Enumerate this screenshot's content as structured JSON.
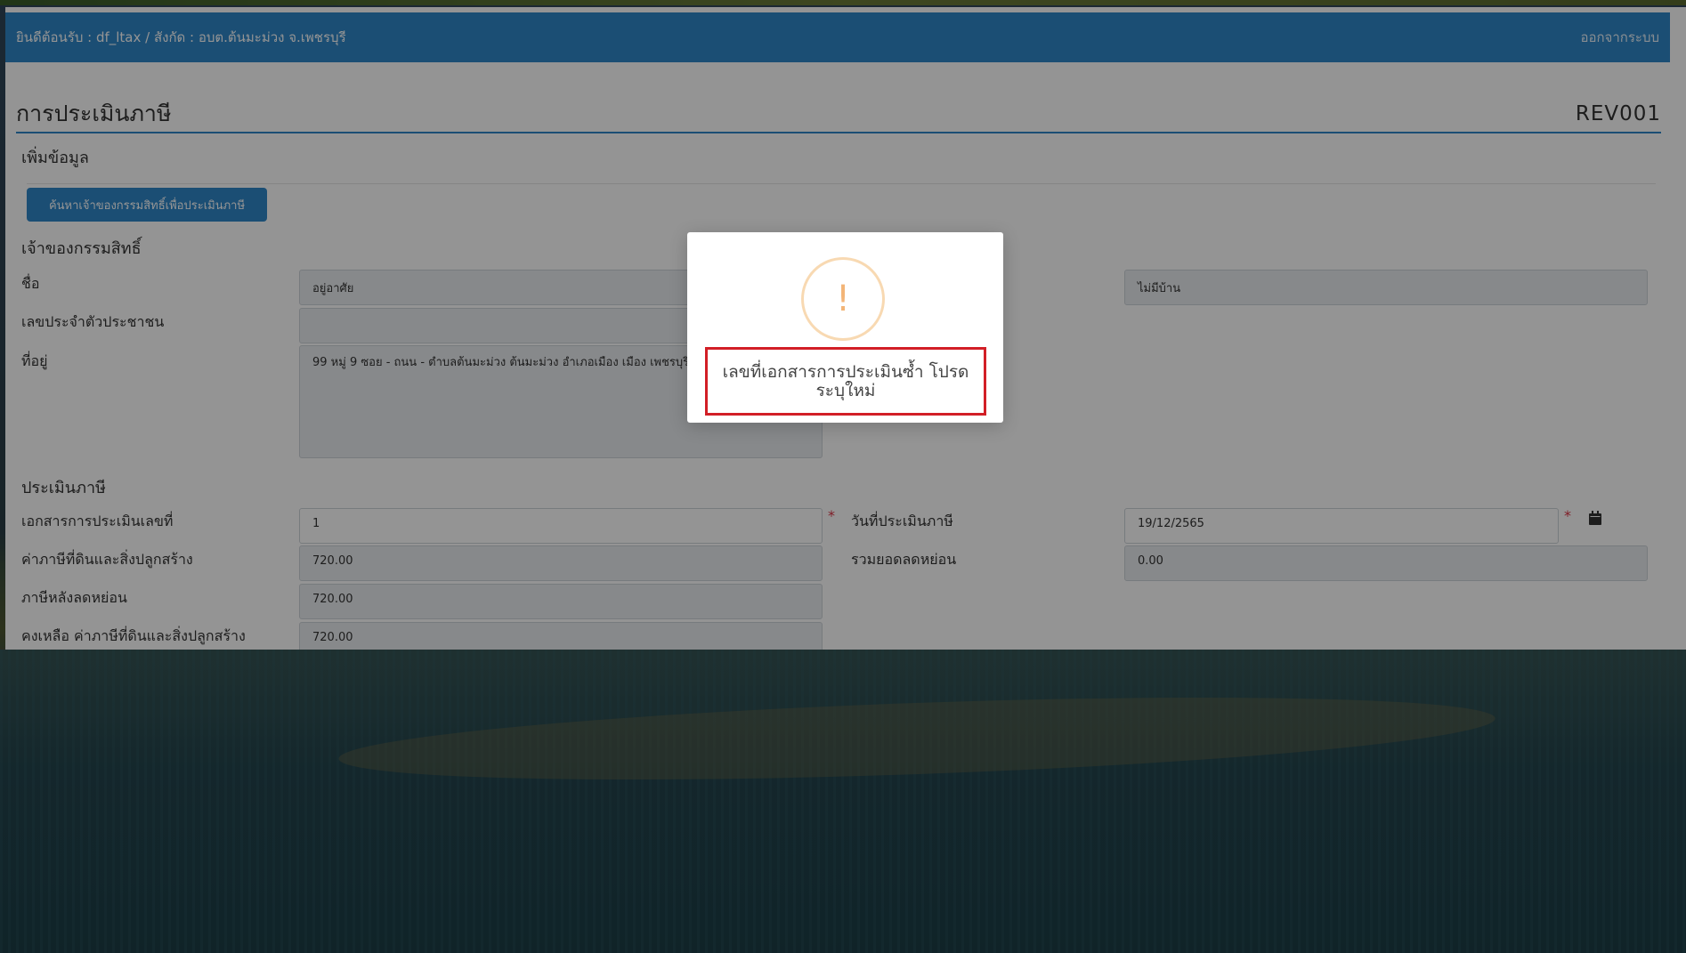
{
  "navbar": {
    "welcome": "ยินดีต้อนรับ : df_ltax / สังกัด : อบต.ต้นมะม่วง จ.เพชรบุรี",
    "logout": "ออกจากระบบ"
  },
  "page": {
    "title": "การประเมินภาษี",
    "code": "REV001",
    "add_data": "เพิ่มข้อมูล",
    "search_button": "ค้นหาเจ้าของกรรมสิทธิ์เพื่อประเมินภาษี"
  },
  "owner": {
    "section": "เจ้าของกรรมสิทธิ์",
    "name_label": "ชื่อ",
    "first_name": "อยู่อาศัย",
    "last_name": "ไม่มีบ้าน",
    "id_label": "เลขประจำตัวประชาชน",
    "id_value": "",
    "address_label": "ที่อยู่",
    "address_value": "99 หมู่ 9 ซอย - ถนน - ตำบลต้นมะม่วง ต้นมะม่วง อำเภอเมือง เมือง เพชรบุรี 76000"
  },
  "assessment": {
    "section": "ประเมินภาษี",
    "doc_no_label": "เอกสารการประเมินเลขที่",
    "doc_no_value": "1",
    "date_label": "วันที่ประเมินภาษี",
    "date_value": "19/12/2565",
    "land_tax_label": "ค่าภาษีที่ดินและสิ่งปลูกสร้าง",
    "land_tax_value": "720.00",
    "discount_label": "รวมยอดลดหย่อน",
    "discount_value": "0.00",
    "after_discount_label": "ภาษีหลังลดหย่อน",
    "after_discount_value": "720.00",
    "remaining_label": "คงเหลือ ค่าภาษีที่ดินและสิ่งปลูกสร้าง",
    "remaining_value": "720.00"
  },
  "modal": {
    "icon_text": "!",
    "message": "เลขที่เอกสารการประเมินซ้ำ โปรดระบุใหม่"
  },
  "colors": {
    "primary": "#2f87c8",
    "warning": "#f3b577",
    "highlight_border": "#d21f26"
  }
}
